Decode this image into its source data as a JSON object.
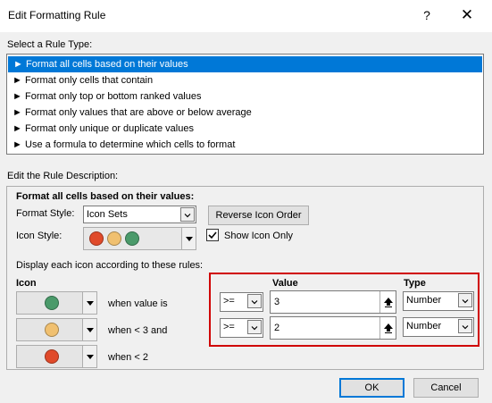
{
  "dialog": {
    "title": "Edit Formatting Rule",
    "help_glyph": "?",
    "close_glyph": "✕"
  },
  "rule_type": {
    "label": "Select a Rule Type:",
    "items": [
      {
        "label": "Format all cells based on their values",
        "selected": true
      },
      {
        "label": "Format only cells that contain",
        "selected": false
      },
      {
        "label": "Format only top or bottom ranked values",
        "selected": false
      },
      {
        "label": "Format only values that are above or below average",
        "selected": false
      },
      {
        "label": "Format only unique or duplicate values",
        "selected": false
      },
      {
        "label": "Use a formula to determine which cells to format",
        "selected": false
      }
    ],
    "arrow_glyph": "►"
  },
  "description": {
    "label": "Edit the Rule Description:",
    "heading": "Format all cells based on their values:",
    "format_style_label": "Format Style:",
    "format_style_value": "Icon Sets",
    "reverse_button": "Reverse Icon Order",
    "icon_style_label": "Icon Style:",
    "show_icon_only_label": "Show Icon Only",
    "show_icon_only_checked": true,
    "display_rules_label": "Display each icon according to these rules:",
    "icon_header": "Icon",
    "value_header": "Value",
    "type_header": "Type",
    "rows": [
      {
        "icon_color": "#4a9a6a",
        "condition": "when value is",
        "operator": ">=",
        "value": "3",
        "type": "Number"
      },
      {
        "icon_color": "#f0c070",
        "condition": "when < 3 and",
        "operator": ">=",
        "value": "2",
        "type": "Number"
      },
      {
        "icon_color": "#e04a2a",
        "condition": "when < 2"
      }
    ]
  },
  "icon_style_colors": [
    "#e04a2a",
    "#f0c070",
    "#4a9a6a"
  ],
  "buttons": {
    "ok": "OK",
    "cancel": "Cancel"
  },
  "colors": {
    "accent": "#0078d7",
    "highlight_frame": "#d00000"
  }
}
